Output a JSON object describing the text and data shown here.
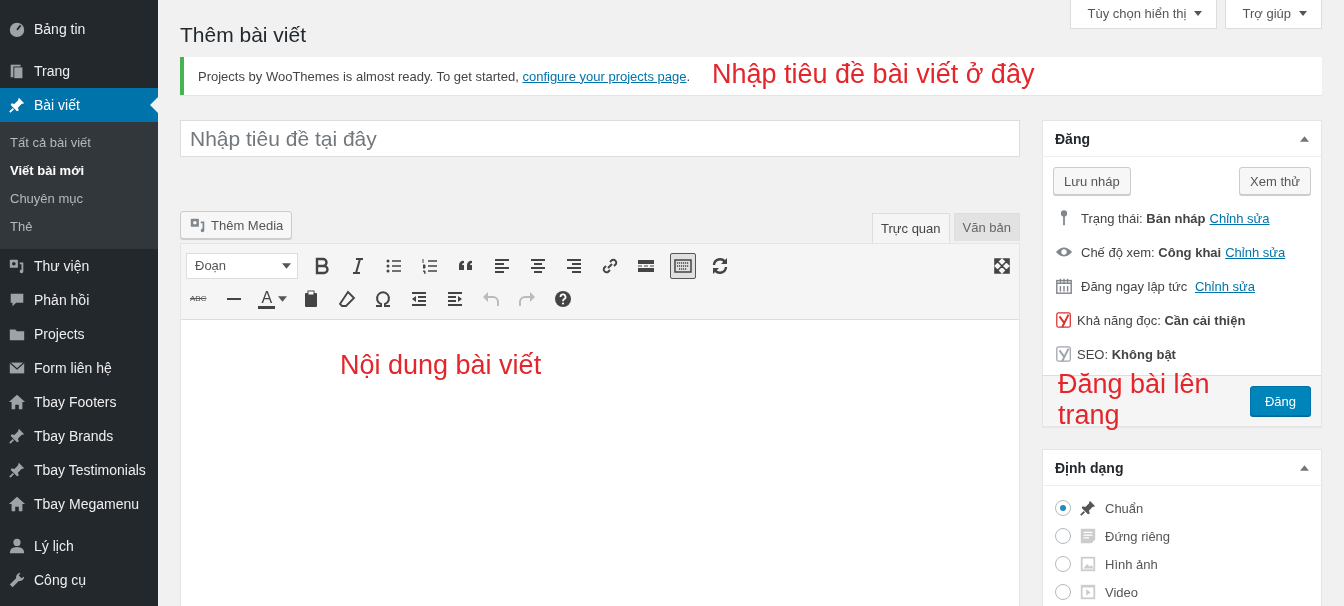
{
  "sidebar": {
    "groups": [
      [
        {
          "label": "Bảng tin",
          "selected": false
        }
      ],
      [
        {
          "label": "Trang",
          "selected": false
        },
        {
          "label": "Bài viết",
          "selected": true,
          "children": [
            {
              "label": "Tất cả bài viết",
              "selected": false
            },
            {
              "label": "Viết bài mới",
              "selected": true
            },
            {
              "label": "Chuyên mục",
              "selected": false
            },
            {
              "label": "Thẻ",
              "selected": false
            }
          ]
        },
        {
          "label": "Thư viện",
          "selected": false
        },
        {
          "label": "Phản hồi",
          "selected": false
        },
        {
          "label": "Projects",
          "selected": false
        },
        {
          "label": "Form liên hệ",
          "selected": false
        },
        {
          "label": "Tbay Footers",
          "selected": false
        },
        {
          "label": "Tbay Brands",
          "selected": false
        },
        {
          "label": "Tbay Testimonials",
          "selected": false
        },
        {
          "label": "Tbay Megamenu",
          "selected": false
        }
      ],
      [
        {
          "label": "Lý lịch",
          "selected": false
        },
        {
          "label": "Công cụ",
          "selected": false
        }
      ]
    ]
  },
  "screen_options": [
    "Tùy chọn hiển thị",
    "Trợ giúp"
  ],
  "page_title": "Thêm bài viết",
  "notice": {
    "text": "Projects by WooThemes is almost ready. To get started, ",
    "link": "configure your projects page",
    "after": "."
  },
  "title_field": {
    "placeholder": "Nhập tiêu đề tại đây"
  },
  "editor": {
    "add_media": "Thêm Media",
    "tabs": [
      {
        "label": "Trực quan",
        "selected": true
      },
      {
        "label": "Văn bản",
        "selected": false
      }
    ],
    "format_select": "Đoạn",
    "strike_label": "ABC",
    "color_label": "A",
    "toolbar_toggle_pressed": true,
    "undo_disabled": true,
    "redo_disabled": true
  },
  "publish": {
    "title": "Đăng",
    "save_draft": "Lưu nháp",
    "preview": "Xem thử",
    "rows": [
      {
        "label": "Trạng thái: ",
        "value": "Bản nháp",
        "link": "Chỉnh sửa"
      },
      {
        "label": "Chế độ xem: ",
        "value": "Công khai",
        "link": "Chỉnh sửa"
      },
      {
        "label": "Đăng ngay lập tức ",
        "link": "Chỉnh sửa"
      },
      {
        "label": "Khả năng đọc: ",
        "value": "Cần cải thiện",
        "color": "#dc3232"
      },
      {
        "label": "SEO: ",
        "value": "Không bật",
        "color": "#a0a5aa"
      }
    ],
    "publish_button": "Đăng"
  },
  "format_box": {
    "title": "Định dạng",
    "options": [
      {
        "label": "Chuẩn",
        "selected": true
      },
      {
        "label": "Đứng riêng",
        "selected": false
      },
      {
        "label": "Hình ảnh",
        "selected": false
      },
      {
        "label": "Video",
        "selected": false
      }
    ]
  },
  "annotations": [
    "Nhập tiêu đề bài viết ở đây",
    "Nội dung bài viết",
    "Đăng bài lên trang"
  ]
}
